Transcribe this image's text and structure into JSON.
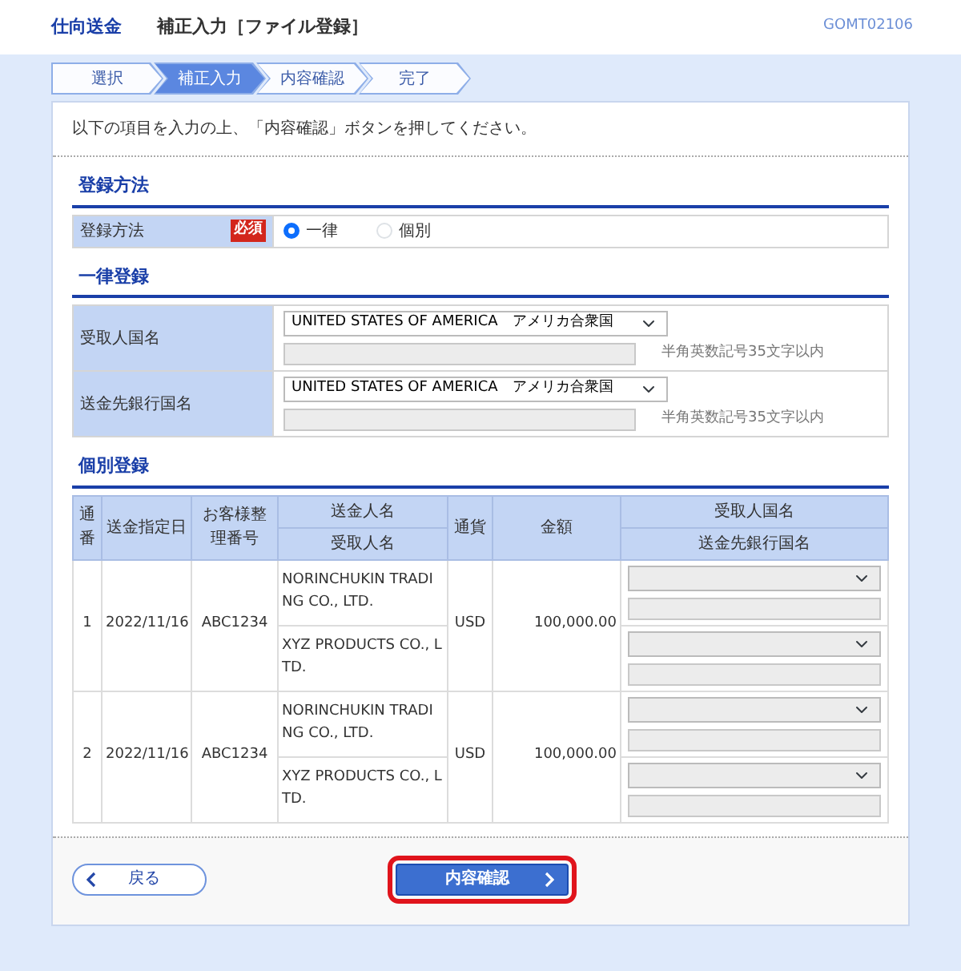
{
  "header": {
    "service": "仕向送金",
    "title": "補正入力［ファイル登録］",
    "screen_id": "GOMT02106"
  },
  "steps": [
    {
      "label": "選択",
      "selected": false
    },
    {
      "label": "補正入力",
      "selected": true
    },
    {
      "label": "内容確認",
      "selected": false
    },
    {
      "label": "完了",
      "selected": false
    }
  ],
  "intro": "以下の項目を入力の上、「内容確認」ボタンを押してください。",
  "method_section": {
    "heading": "登録方法",
    "label": "登録方法",
    "required_badge": "必須",
    "options": [
      {
        "label": "一律",
        "selected": true
      },
      {
        "label": "個別",
        "selected": false
      }
    ]
  },
  "bulk_section": {
    "heading": "一律登録",
    "fields": [
      {
        "label": "受取人国名",
        "select_value": "UNITED STATES OF AMERICA　アメリカ合衆国",
        "text_disabled": true,
        "hint": "半角英数記号35文字以内"
      },
      {
        "label": "送金先銀行国名",
        "select_value": "UNITED STATES OF AMERICA　アメリカ合衆国",
        "text_disabled": true,
        "hint": "半角英数記号35文字以内"
      }
    ]
  },
  "individual_section": {
    "heading": "個別登録",
    "columns": [
      {
        "labels": [
          "通番"
        ]
      },
      {
        "labels": [
          "送金指定日"
        ]
      },
      {
        "labels": [
          "お客様整理番号"
        ]
      },
      {
        "labels": [
          "送金人名",
          "受取人名"
        ]
      },
      {
        "labels": [
          "通貨"
        ]
      },
      {
        "labels": [
          "金額"
        ]
      },
      {
        "labels": [
          "受取人国名",
          "送金先銀行国名"
        ]
      }
    ],
    "rows": [
      {
        "no": "1",
        "date": "2022/11/16",
        "reference": "ABC1234",
        "sender": "NORINCHUKIN TRADING CO., LTD.",
        "recipient": "XYZ PRODUCTS CO., LTD.",
        "currency": "USD",
        "amount": "100,000.00",
        "disabled": true
      },
      {
        "no": "2",
        "date": "2022/11/16",
        "reference": "ABC1234",
        "sender": "NORINCHUKIN TRADING CO., LTD.",
        "recipient": "XYZ PRODUCTS CO., LTD.",
        "currency": "USD",
        "amount": "100,000.00",
        "disabled": true
      }
    ]
  },
  "buttons": {
    "back": {
      "label": "戻る"
    },
    "confirm": {
      "label": "内容確認",
      "highlighted": true
    }
  }
}
